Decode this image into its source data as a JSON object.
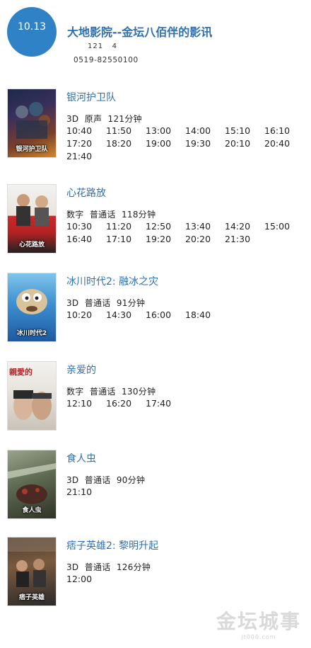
{
  "header": {
    "date": "10.13",
    "cinema_name": "大地影院--金坛八佰伴的影讯",
    "meta": "121   4",
    "phone": "0519-82550100"
  },
  "movies": [
    {
      "title": "银河护卫队",
      "info": "3D  原声  121分钟",
      "poster_text": "银河护卫队",
      "times": [
        "10:40",
        "11:50",
        "13:00",
        "14:00",
        "15:10",
        "16:10",
        "17:20",
        "18:20",
        "19:00",
        "19:30",
        "20:10",
        "20:40",
        "21:40"
      ]
    },
    {
      "title": "心花路放",
      "info": "数字  普通话  118分钟",
      "poster_text": "心花路放",
      "times": [
        "10:30",
        "11:20",
        "12:50",
        "13:40",
        "14:20",
        "15:00",
        "16:40",
        "17:10",
        "19:20",
        "20:20",
        "21:30"
      ]
    },
    {
      "title": "冰川时代2: 融冰之灾",
      "info": "3D  普通话  91分钟",
      "poster_text": "冰川时代2",
      "times": [
        "10:20",
        "14:30",
        "16:00",
        "18:40"
      ]
    },
    {
      "title": "亲爱的",
      "info": "数字  普通话  130分钟",
      "poster_text": "親愛的",
      "times": [
        "12:10",
        "16:20",
        "17:40"
      ]
    },
    {
      "title": "食人虫",
      "info": "3D  普通话  90分钟",
      "poster_text": "食人虫",
      "times": [
        "21:10"
      ]
    },
    {
      "title": "痞子英雄2: 黎明升起",
      "info": "3D  普通话  126分钟",
      "poster_text": "痞子英雄",
      "times": [
        "12:00"
      ]
    }
  ],
  "watermark": {
    "main": "金坛城事",
    "sub": "jt000.com"
  },
  "colors": {
    "accent": "#2f82c6",
    "title_blue": "#2f6fb0"
  }
}
